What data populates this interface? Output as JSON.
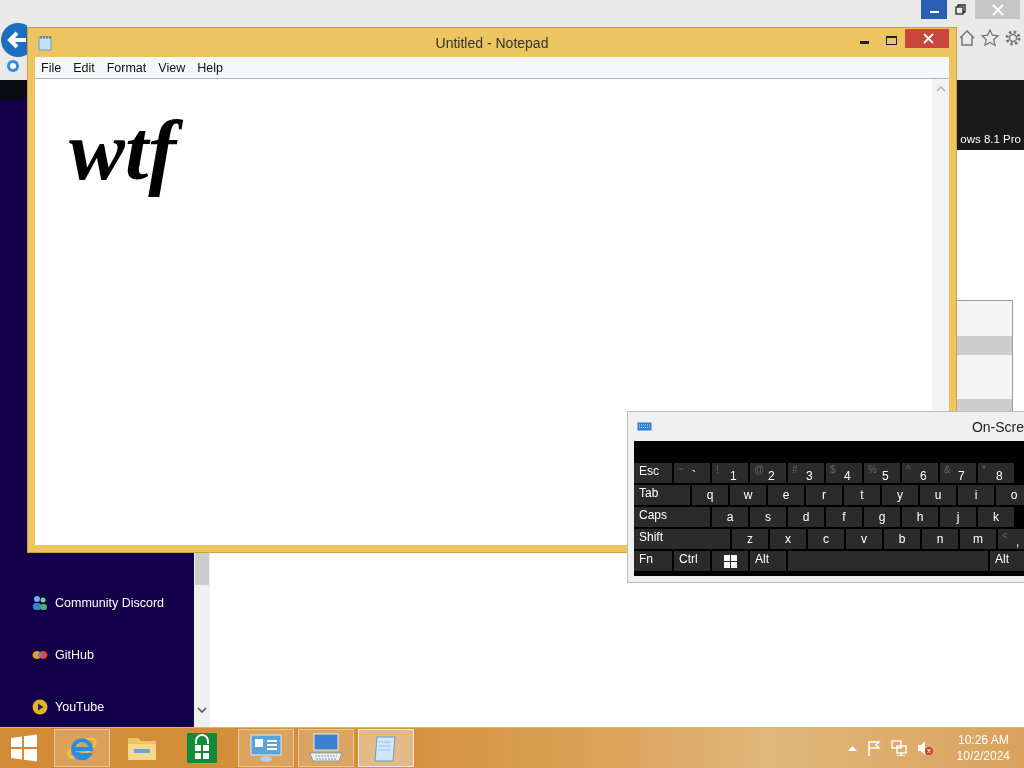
{
  "browser": {
    "banner_text": "ows 8.1 Pro",
    "sidebar": {
      "items": [
        {
          "label": "Community Discord",
          "kind": "people"
        },
        {
          "label": "GitHub",
          "kind": "knot"
        },
        {
          "label": "YouTube",
          "kind": "play"
        }
      ]
    }
  },
  "notepad": {
    "title": "Untitled - Notepad",
    "menu": [
      "File",
      "Edit",
      "Format",
      "View",
      "Help"
    ],
    "content": "wtf"
  },
  "osk": {
    "title": "On-Scre",
    "rows": [
      [
        {
          "kind": "modifier",
          "label": "Esc"
        },
        {
          "kind": "symbol",
          "shift": "~",
          "label": "`"
        },
        {
          "kind": "symbol",
          "shift": "!",
          "label": "1"
        },
        {
          "kind": "symbol",
          "shift": "@",
          "label": "2"
        },
        {
          "kind": "symbol",
          "shift": "#",
          "label": "3"
        },
        {
          "kind": "symbol",
          "shift": "$",
          "label": "4"
        },
        {
          "kind": "symbol",
          "shift": "%",
          "label": "5"
        },
        {
          "kind": "symbol",
          "shift": "^",
          "label": "6"
        },
        {
          "kind": "symbol",
          "shift": "&",
          "label": "7"
        },
        {
          "kind": "symbol",
          "shift": "*",
          "label": "8"
        }
      ],
      [
        {
          "kind": "modifier",
          "label": "Tab"
        },
        {
          "kind": "char",
          "label": "q"
        },
        {
          "kind": "char",
          "label": "w"
        },
        {
          "kind": "char",
          "label": "e"
        },
        {
          "kind": "char",
          "label": "r"
        },
        {
          "kind": "char",
          "label": "t"
        },
        {
          "kind": "char",
          "label": "y"
        },
        {
          "kind": "char",
          "label": "u"
        },
        {
          "kind": "char",
          "label": "i"
        },
        {
          "kind": "char",
          "label": "o"
        }
      ],
      [
        {
          "kind": "modifier",
          "label": "Caps"
        },
        {
          "kind": "char",
          "label": "a"
        },
        {
          "kind": "char",
          "label": "s"
        },
        {
          "kind": "char",
          "label": "d"
        },
        {
          "kind": "char",
          "label": "f"
        },
        {
          "kind": "char",
          "label": "g"
        },
        {
          "kind": "char",
          "label": "h"
        },
        {
          "kind": "char",
          "label": "j"
        },
        {
          "kind": "char",
          "label": "k"
        }
      ],
      [
        {
          "kind": "modifier",
          "label": "Shift"
        },
        {
          "kind": "char",
          "label": "z"
        },
        {
          "kind": "char",
          "label": "x"
        },
        {
          "kind": "char",
          "label": "c"
        },
        {
          "kind": "char",
          "label": "v"
        },
        {
          "kind": "char",
          "label": "b"
        },
        {
          "kind": "char",
          "label": "n"
        },
        {
          "kind": "char",
          "label": "m"
        },
        {
          "kind": "symbol",
          "shift": "<",
          "label": ","
        }
      ],
      [
        {
          "kind": "modifier",
          "label": "Fn"
        },
        {
          "kind": "modifier",
          "label": "Ctrl"
        },
        {
          "kind": "windows"
        },
        {
          "kind": "modifier",
          "label": "Alt"
        },
        {
          "kind": "space"
        },
        {
          "kind": "modifier",
          "label": "Alt"
        }
      ]
    ]
  },
  "taskbar": {
    "apps": [
      {
        "kind": "ie",
        "running": true,
        "selected": false
      },
      {
        "kind": "explorer",
        "running": false,
        "selected": false
      },
      {
        "kind": "store",
        "running": false,
        "selected": false
      },
      {
        "kind": "control",
        "running": true,
        "selected": false
      },
      {
        "kind": "osk",
        "running": true,
        "selected": false
      },
      {
        "kind": "notepad",
        "running": true,
        "selected": true
      }
    ],
    "time": "10:26 AM",
    "date": "10/2/2024"
  }
}
